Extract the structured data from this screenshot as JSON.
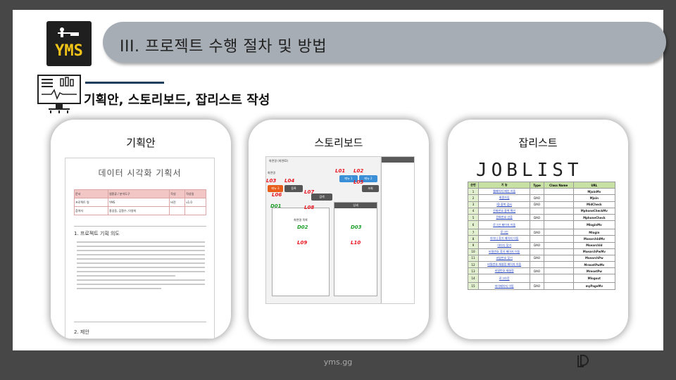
{
  "logo": {
    "text": "YMS"
  },
  "header": {
    "title": "III. 프로젝트 수행 절차 및 방법"
  },
  "subtitle": "기획안, 스토리보드, 잡리스트 작성",
  "cards": [
    {
      "title": "기획안",
      "doc": {
        "heading": "데이터 시각화 기획서",
        "rows": [
          [
            "문서",
            "앱종류 / 분석도구",
            "작성",
            "작성일"
          ],
          [
            "프로젝트 명",
            "YMS",
            "버전",
            "v1.0"
          ],
          [
            "참여자",
            "홍길동, 김철수, 이영희",
            "",
            ""
          ]
        ],
        "section1": "1. 프로젝트 기획 의도",
        "section2": "2. 제안"
      }
    },
    {
      "title": "스토리보드",
      "storyboard": {
        "top_label": "화면명 (화면ID)",
        "left_label": "화면명",
        "buttons": [
          "메뉴 1",
          "메뉴 2",
          "메뉴 3",
          "등록",
          "조회",
          "검색"
        ],
        "pane_titles": [
          "화면명 목록",
          "상세"
        ],
        "codes_red": [
          "L01",
          "L02",
          "L03",
          "L04",
          "L05",
          "L06",
          "L07",
          "L08",
          "L09",
          "L10"
        ],
        "codes_green": [
          "D01",
          "D02",
          "D03"
        ]
      }
    },
    {
      "title": "잡리스트",
      "joblist": {
        "title": "JOBLIST",
        "headers": [
          "순번",
          "기 능",
          "Type",
          "Class Name",
          "URL"
        ],
        "rows": [
          {
            "no": "1",
            "func": "웹페이지 메인 이동",
            "type": "",
            "url": "MjoinMv"
          },
          {
            "no": "2",
            "func": "회원가입",
            "type": "DAO",
            "url": "Mjoin"
          },
          {
            "no": "3",
            "func": "ID 중복 검사",
            "type": "DAO",
            "url": "MidCheck"
          },
          {
            "no": "4",
            "func": "전화번호 중복 확인",
            "type": "",
            "url": "MphoneCheckMv"
          },
          {
            "no": "5",
            "func": "전화번호 인증",
            "type": "DAO",
            "url": "MphoneCheck"
          },
          {
            "no": "6",
            "func": "로그인 페이지 이동",
            "type": "",
            "url": "MloginMv"
          },
          {
            "no": "7",
            "func": "로그인",
            "type": "DAO",
            "url": "Mlogin"
          },
          {
            "no": "8",
            "func": "아이디 찾기 페이지 이동",
            "type": "",
            "url": "MsearchIdMv"
          },
          {
            "no": "9",
            "func": "아이디 찾기",
            "type": "DAO",
            "url": "MsearchId"
          },
          {
            "no": "10",
            "func": "비밀번호 찾기 페이지 이동",
            "type": "",
            "url": "MsearchPwMv"
          },
          {
            "no": "11",
            "func": "비밀번호 찾기",
            "type": "DAO",
            "url": "MsearchPw"
          },
          {
            "no": "12",
            "func": "비밀번호 재설정 페이지 이동",
            "type": "",
            "url": "MresetPwMv"
          },
          {
            "no": "13",
            "func": "비밀번호 재설정",
            "type": "DAO",
            "url": "MresetPw"
          },
          {
            "no": "14",
            "func": "로그아웃",
            "type": "",
            "url": "Mlogout"
          },
          {
            "no": "15",
            "func": "마이페이지 이동",
            "type": "DAO",
            "url": "myPageMv"
          }
        ]
      }
    }
  ],
  "footer": {
    "text": "yms.gg"
  },
  "colors": {
    "logo_text": "#f2c318",
    "pill": "#a7adb4",
    "accent_rule": "#1e3c5c",
    "code_red": "#e8141e",
    "code_green": "#1e9e2a"
  }
}
